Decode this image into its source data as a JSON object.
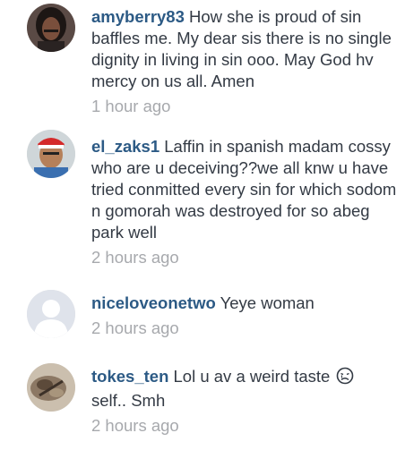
{
  "comments": [
    {
      "username": "amyberry83",
      "text": "How she is proud of sin baffles me. My dear sis there is no single dignity in living in sin ooo. May God hv mercy on us all. Amen",
      "time": "1 hour ago",
      "avatar": "avatar-photo-woman"
    },
    {
      "username": "el_zaks1",
      "text": "Laffin in spanish madam cossy who are u deceiving??we all knw u have tried conmitted every sin for which sodom n gomorah was destroyed for so abeg park well",
      "time": "2 hours ago",
      "avatar": "avatar-photo-man-red-cap"
    },
    {
      "username": "niceloveonetwo",
      "text": "Yeye woman",
      "time": "2 hours ago",
      "avatar": "default-avatar-icon"
    },
    {
      "username": "tokes_ten",
      "text": "Lol u av a weird taste",
      "text_after_emoji": "self.. Smh",
      "emoji": "crying-face-emoji",
      "time": "2 hours ago",
      "avatar": "avatar-photo-food"
    }
  ],
  "colors": {
    "username": "#2c5a85",
    "text": "#333a44",
    "timestamp": "#a7a9ad",
    "background": "#ffffff"
  }
}
